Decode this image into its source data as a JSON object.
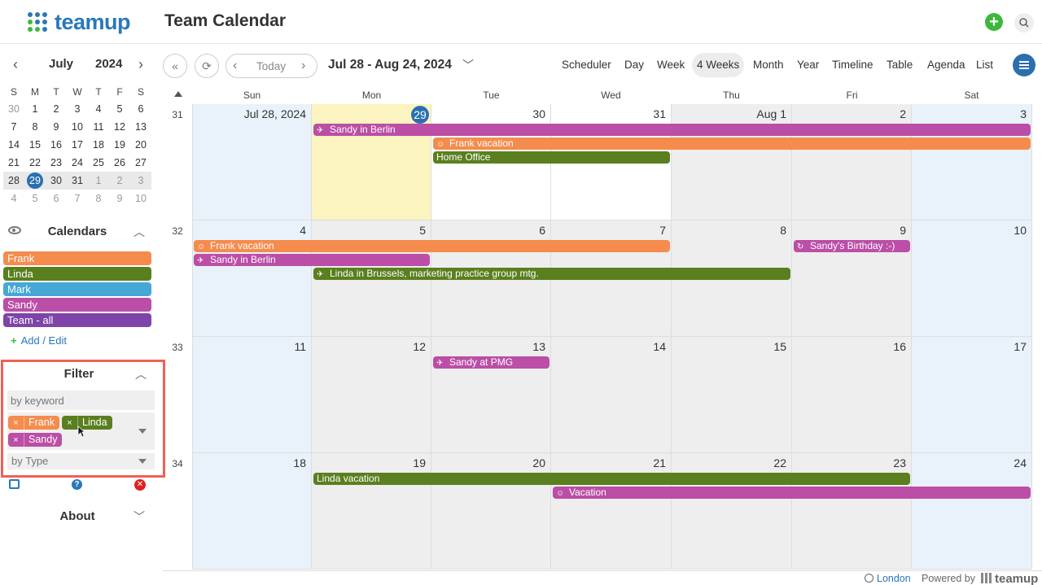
{
  "app": {
    "name": "teamup",
    "title": "Team Calendar"
  },
  "mini_calendar": {
    "month": "July",
    "year": "2024",
    "weekdays": [
      "S",
      "M",
      "T",
      "W",
      "T",
      "F",
      "S"
    ],
    "weeks": [
      [
        "30",
        "1",
        "2",
        "3",
        "4",
        "5",
        "6"
      ],
      [
        "7",
        "8",
        "9",
        "10",
        "11",
        "12",
        "13"
      ],
      [
        "14",
        "15",
        "16",
        "17",
        "18",
        "19",
        "20"
      ],
      [
        "21",
        "22",
        "23",
        "24",
        "25",
        "26",
        "27"
      ],
      [
        "28",
        "29",
        "30",
        "31",
        "1",
        "2",
        "3"
      ],
      [
        "4",
        "5",
        "6",
        "7",
        "8",
        "9",
        "10"
      ]
    ],
    "today": "29"
  },
  "calendars": {
    "title": "Calendars",
    "items": [
      {
        "label": "Frank",
        "color": "#f58c4e"
      },
      {
        "label": "Linda",
        "color": "#5a7f1f"
      },
      {
        "label": "Mark",
        "color": "#45a8d6"
      },
      {
        "label": "Sandy",
        "color": "#bb4ea6"
      },
      {
        "label": "Team - all",
        "color": "#7e44a8"
      }
    ],
    "add_edit": "Add / Edit"
  },
  "filter": {
    "title": "Filter",
    "keyword_placeholder": "by keyword",
    "tags": [
      {
        "label": "Frank",
        "color": "#f58c4e"
      },
      {
        "label": "Linda",
        "color": "#5a7f1f"
      },
      {
        "label": "Sandy",
        "color": "#bb4ea6"
      }
    ],
    "type_placeholder": "by Type"
  },
  "about": {
    "title": "About"
  },
  "toolbar": {
    "today": "Today",
    "date_range": "Jul 28 - Aug 24, 2024",
    "views": [
      "Scheduler",
      "Day",
      "Week",
      "4 Weeks",
      "Month",
      "Year",
      "Timeline",
      "Table",
      "Agenda",
      "List"
    ],
    "active_view": "4 Weeks"
  },
  "grid": {
    "day_names": [
      "Sun",
      "Mon",
      "Tue",
      "Wed",
      "Thu",
      "Fri",
      "Sat"
    ],
    "weeks": [
      {
        "num": "31",
        "days": [
          "Jul 28, 2024",
          "29",
          "30",
          "31",
          "Aug 1",
          "2",
          "3"
        ]
      },
      {
        "num": "32",
        "days": [
          "4",
          "5",
          "6",
          "7",
          "8",
          "9",
          "10"
        ]
      },
      {
        "num": "33",
        "days": [
          "11",
          "12",
          "13",
          "14",
          "15",
          "16",
          "17"
        ]
      },
      {
        "num": "34",
        "days": [
          "18",
          "19",
          "20",
          "21",
          "22",
          "23",
          "24"
        ]
      }
    ],
    "events": [
      {
        "title": "Sandy in Berlin",
        "icon": "plane-icon",
        "color": "#bb4ea6",
        "week": 0,
        "start": 1,
        "end": 6,
        "lane": 0
      },
      {
        "title": "Frank vacation",
        "icon": "smiley-icon",
        "color": "#f58c4e",
        "week": 0,
        "start": 2,
        "end": 6,
        "lane": 1
      },
      {
        "title": "Home Office",
        "icon": "",
        "color": "#5a7f1f",
        "week": 0,
        "start": 2,
        "end": 3,
        "lane": 2
      },
      {
        "title": "Frank vacation",
        "icon": "smiley-icon",
        "color": "#f58c4e",
        "week": 1,
        "start": 0,
        "end": 3,
        "lane": 0
      },
      {
        "title": "Sandy's Birthday :-)",
        "icon": "repeat-icon",
        "color": "#bb4ea6",
        "week": 1,
        "start": 5,
        "end": 5,
        "lane": 0
      },
      {
        "title": "Sandy in Berlin",
        "icon": "plane-icon",
        "color": "#bb4ea6",
        "week": 1,
        "start": 0,
        "end": 1,
        "lane": 1
      },
      {
        "title": "Linda in Brussels, marketing practice group mtg.",
        "icon": "plane-icon",
        "color": "#5a7f1f",
        "week": 1,
        "start": 1,
        "end": 4,
        "lane": 2
      },
      {
        "title": "Sandy at PMG",
        "icon": "plane-icon",
        "color": "#bb4ea6",
        "week": 2,
        "start": 2,
        "end": 2,
        "lane": 0
      },
      {
        "title": "Linda vacation",
        "icon": "",
        "color": "#5a7f1f",
        "week": 3,
        "start": 1,
        "end": 5,
        "lane": 0
      },
      {
        "title": "Vacation",
        "icon": "smiley-icon",
        "color": "#bb4ea6",
        "week": 3,
        "start": 3,
        "end": 6,
        "lane": 1
      }
    ]
  },
  "footer": {
    "timezone": "London",
    "powered_by": "Powered by",
    "brand": "teamup"
  }
}
